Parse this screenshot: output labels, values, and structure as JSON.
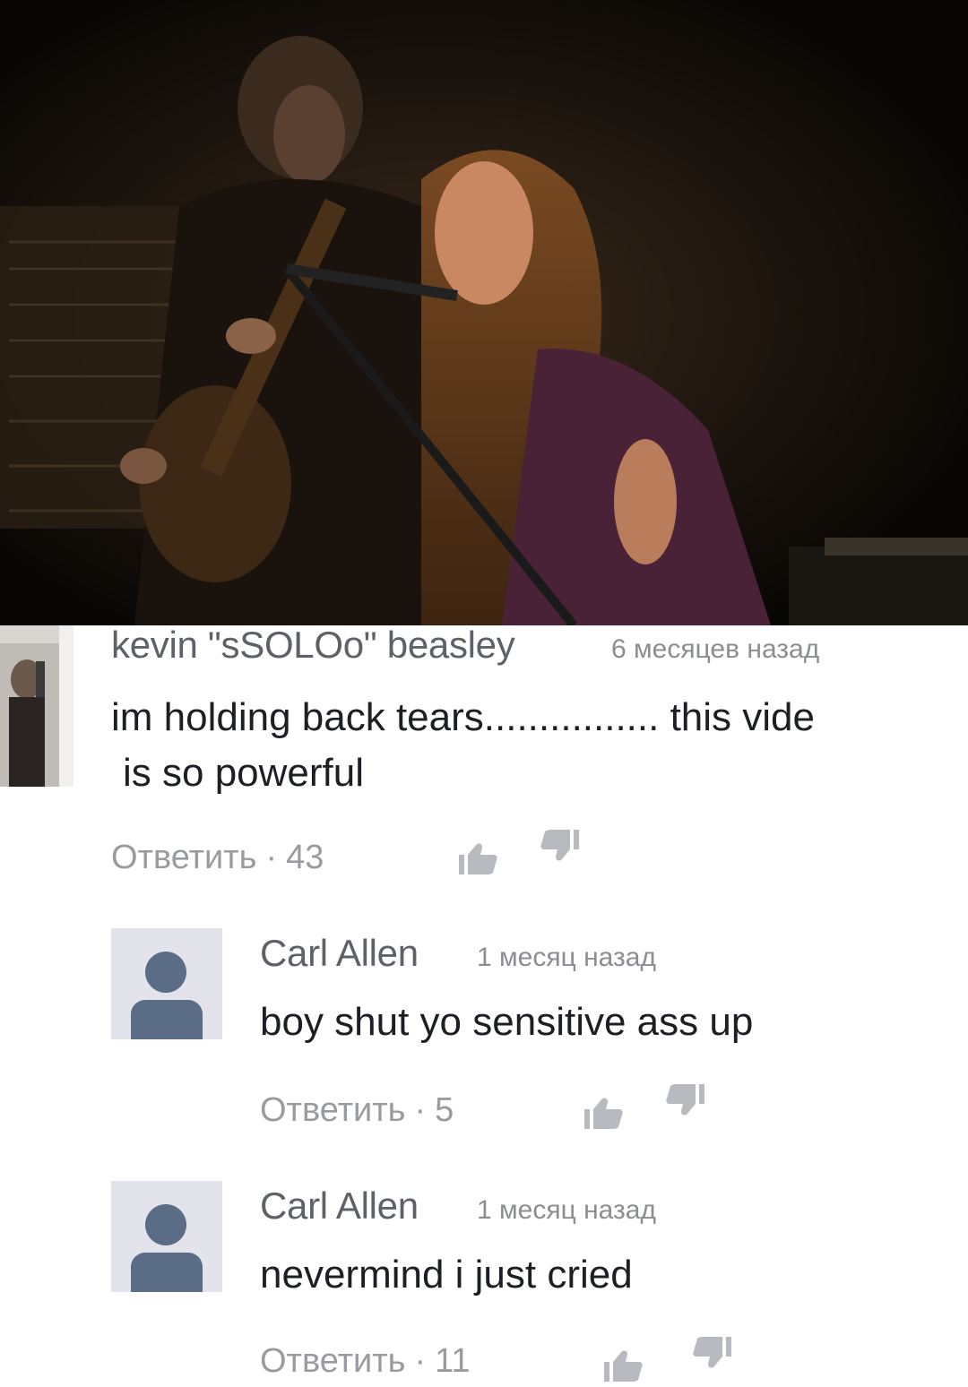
{
  "video": {
    "description_icon": "video-frame"
  },
  "comments": [
    {
      "author": "kevin \"sSOLOo\" beasley",
      "time": "6 месяцев назад",
      "text_line1": "im holding back tears................ this vide",
      "text_line2": "is so powerful",
      "reply_label": "Ответить",
      "likes": "43",
      "like_icon": "thumb-up-icon",
      "dislike_icon": "thumb-down-icon"
    },
    {
      "author": "Carl Allen",
      "time": "1 месяц назад",
      "text_line1": "boy shut yo sensitive ass up",
      "reply_label": "Ответить",
      "likes": "5",
      "like_icon": "thumb-up-icon",
      "dislike_icon": "thumb-down-icon"
    },
    {
      "author": "Carl Allen",
      "time": "1 месяц назад",
      "text_line1": "nevermind i just cried",
      "reply_label": "Ответить",
      "likes": "11",
      "like_icon": "thumb-up-icon",
      "dislike_icon": "thumb-down-icon"
    }
  ]
}
